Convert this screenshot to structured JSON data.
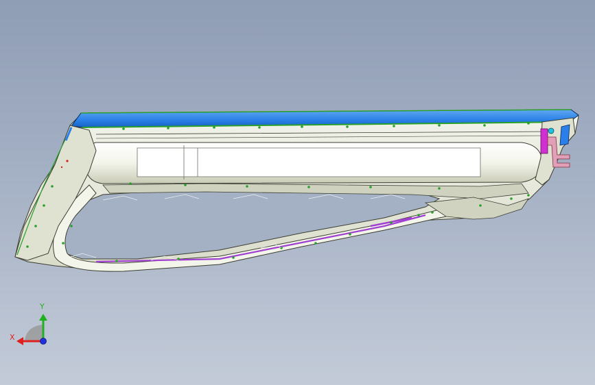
{
  "viewport": {
    "background_top": "#8f9db5",
    "background_bottom": "#c3cbd8"
  },
  "triad": {
    "x_label": "X",
    "y_label": "Y",
    "x_color": "#e0201e",
    "y_color": "#20b020",
    "z_color": "#2030e0"
  },
  "model": {
    "description_icon": "cad-part-icon",
    "highlight_colors": {
      "top_rail": "#2a80e8",
      "green_edges": "#2aa02a",
      "purple_seal": "#a040d0",
      "pink_bracket": "#e0a0b8",
      "magenta_clip": "#d030d0",
      "cyan_marker": "#20c0e0"
    }
  }
}
